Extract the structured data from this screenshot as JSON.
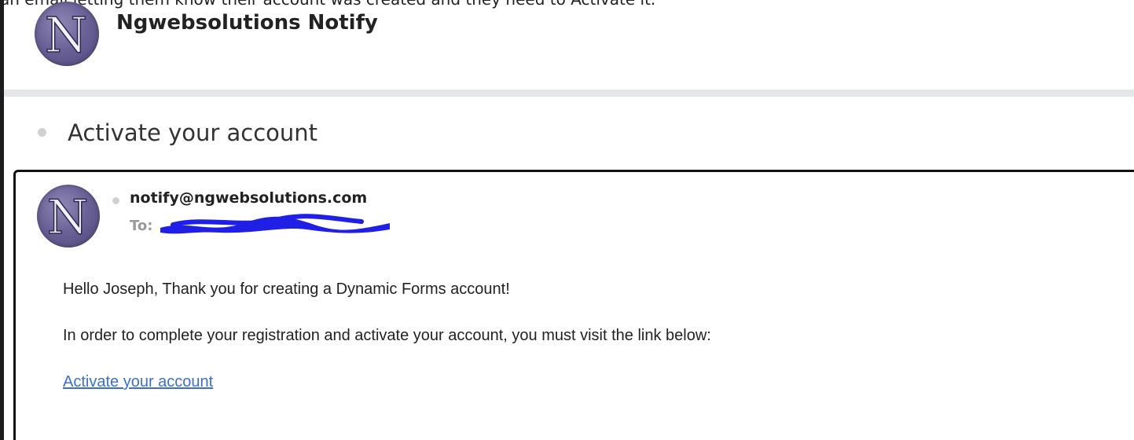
{
  "caption": "an email letting them know their account was created and they need to Activate it.",
  "header": {
    "sender_name": "Ngwebsolutions Notify",
    "avatar_letter": "N"
  },
  "subject": "Activate your account",
  "message": {
    "from": "notify@ngwebsolutions.com",
    "to_label": "To:",
    "greeting": "Hello Joseph, Thank you for creating a Dynamic Forms account!",
    "instruction": "In order to complete your registration and activate your account, you must visit the link below:",
    "link_text": "Activate your account"
  },
  "colors": {
    "link": "#3b6fd6",
    "redaction": "#1f1fe6",
    "avatar": "#6b6398"
  },
  "icons": {
    "avatar": "avatar-n-icon",
    "status_dot": "status-dot-icon"
  }
}
